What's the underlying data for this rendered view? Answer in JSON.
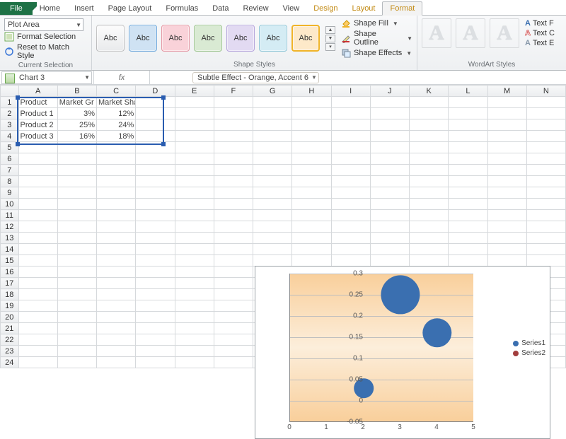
{
  "tabs": {
    "file": "File",
    "home": "Home",
    "insert": "Insert",
    "page_layout": "Page Layout",
    "formulas": "Formulas",
    "data": "Data",
    "review": "Review",
    "view": "View",
    "design": "Design",
    "layout": "Layout",
    "format": "Format"
  },
  "ribbon": {
    "current_selection": {
      "dropdown_value": "Plot Area",
      "format_selection": "Format Selection",
      "reset": "Reset to Match Style",
      "group_label": "Current Selection"
    },
    "shape_styles": {
      "sample_label": "Abc",
      "shape_fill": "Shape Fill",
      "shape_outline": "Shape Outline",
      "shape_effects": "Shape Effects",
      "group_label": "Shape Styles"
    },
    "wordart": {
      "letter": "A",
      "text_fill": "Text F",
      "text_outline": "Text C",
      "text_effects": "Text E",
      "group_label": "WordArt Styles"
    }
  },
  "name_box": "Chart 3",
  "fx_label": "fx",
  "style_pill": "Subtle Effect - Orange, Accent 6",
  "columns": [
    "A",
    "B",
    "C",
    "D",
    "E",
    "F",
    "G",
    "H",
    "I",
    "J",
    "K",
    "L",
    "M",
    "N"
  ],
  "rows": 24,
  "data_cells": {
    "A1": "Product",
    "B1": "Market Gr",
    "C1": "Market Share",
    "A2": "Product 1",
    "B2": "3%",
    "C2": "12%",
    "A3": "Product 2",
    "B3": "25%",
    "C3": "24%",
    "A4": "Product 3",
    "B4": "16%",
    "C4": "18%"
  },
  "legend": {
    "s1": "Series1",
    "s2": "Series2"
  },
  "chart_data": {
    "type": "scatter",
    "title": "",
    "xlabel": "",
    "ylabel": "",
    "xlim": [
      0,
      5
    ],
    "ylim": [
      -0.05,
      0.3
    ],
    "xticks": [
      0,
      1,
      2,
      3,
      4,
      5
    ],
    "yticks": [
      -0.05,
      0,
      0.05,
      0.1,
      0.15,
      0.2,
      0.25,
      0.3
    ],
    "series": [
      {
        "name": "Series1",
        "points": [
          {
            "x": 2,
            "y": 0.03,
            "size": 0.12
          },
          {
            "x": 3,
            "y": 0.25,
            "size": 0.24
          },
          {
            "x": 4,
            "y": 0.16,
            "size": 0.18
          }
        ],
        "color": "#3a6fb0"
      },
      {
        "name": "Series2",
        "points": [],
        "color": "#a23e3e"
      }
    ]
  }
}
